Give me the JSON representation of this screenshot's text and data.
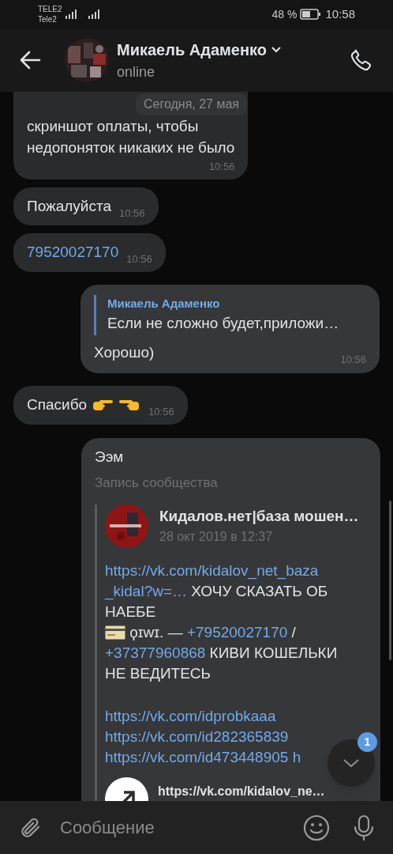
{
  "status_bar": {
    "carrier_1": "TELE2",
    "carrier_2": "Tele2",
    "battery": "48 %",
    "time": "10:58"
  },
  "header": {
    "name": "Микаель Адаменко",
    "status": "online"
  },
  "date_pill": "Сегодня, 27 мая",
  "messages": [
    {
      "kind": "text",
      "outgoing": false,
      "lines": [
        "скриншот оплаты, чтобы",
        "недопоняток никаких не было"
      ],
      "time": "10:56",
      "cut_top": true
    },
    {
      "kind": "text",
      "outgoing": false,
      "lines": [
        "Пожалуйста"
      ],
      "time": "10:56"
    },
    {
      "kind": "link",
      "outgoing": false,
      "lines": [
        "79520027170"
      ],
      "time": "10:56"
    },
    {
      "kind": "reply",
      "outgoing": true,
      "reply_author": "Микаель Адаменко",
      "reply_text": "Если не сложно будет,приложи…",
      "lines": [
        "Хорошо)"
      ],
      "time": "10:56"
    },
    {
      "kind": "emoji",
      "outgoing": false,
      "lines": [
        "Спасибо"
      ],
      "emojis": [
        {
          "kind": "point_right"
        },
        {
          "kind": "point_left"
        }
      ],
      "time": "10:56"
    },
    {
      "kind": "post",
      "outgoing": true,
      "lines": [
        "Ээм"
      ],
      "post_label": "Запись сообщества",
      "post": {
        "author": "Кидалов.нет|база мошен…",
        "date": "28 окт 2019 в 12:37",
        "paragraphs": [
          [
            [
              {
                "kind": "link",
                "text": "https://vk.com/kidalov_net_baza"
              }
            ],
            [
              {
                "kind": "link",
                "text": "_kidal?w=…"
              },
              {
                "kind": "text",
                "text": " ХОЧУ СКАЗАТЬ ОБ"
              }
            ],
            [
              {
                "kind": "text",
                "text": "НАЕБЕ"
              }
            ],
            [
              {
                "kind": "card"
              },
              {
                "kind": "text",
                "text": " ϙɪwɪ. — "
              },
              {
                "kind": "link",
                "text": "+79520027170"
              },
              {
                "kind": "text",
                "text": " /"
              }
            ],
            [
              {
                "kind": "link",
                "text": "+37377960868"
              },
              {
                "kind": "text",
                "text": " КИВИ КОШЕЛЬКИ"
              }
            ],
            [
              {
                "kind": "text",
                "text": "НЕ ВЕДИТЕСЬ"
              }
            ]
          ],
          [
            [
              {
                "kind": "link",
                "text": "https://vk.com/idprobkaaa"
              }
            ],
            [
              {
                "kind": "link",
                "text": "https://vk.com/id282365839"
              }
            ],
            [
              {
                "kind": "link",
                "text": "https://vk.com/id473448905 h"
              }
            ]
          ]
        ],
        "attachment": "https://vk.com/kidalov_ne…"
      }
    }
  ],
  "scroll_button": {
    "badge": "1"
  },
  "composer": {
    "placeholder": "Сообщение"
  }
}
